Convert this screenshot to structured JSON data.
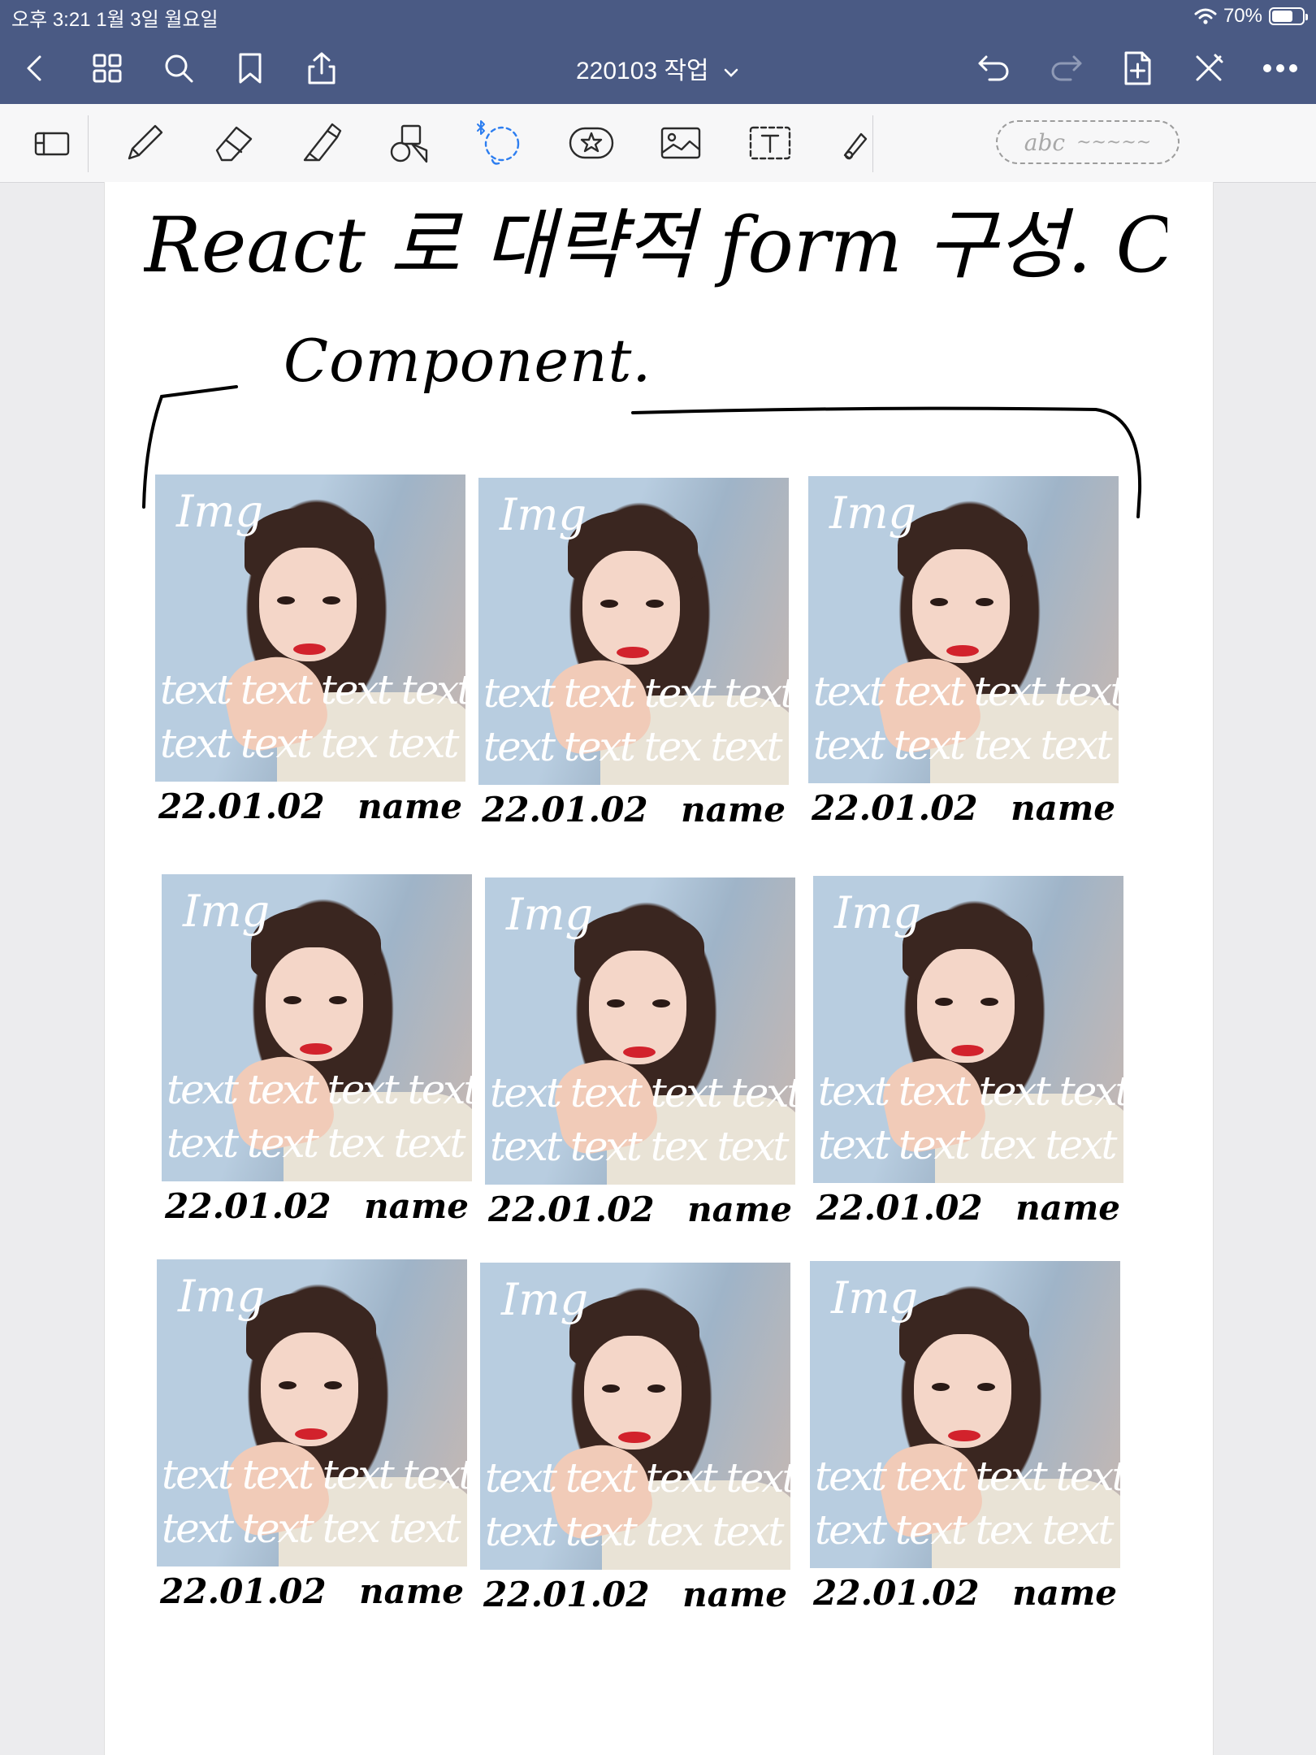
{
  "status_bar": {
    "time": "오후 3:21  1월 3일 월요일",
    "battery": "70%",
    "battery_level": 0.7
  },
  "nav": {
    "doc_title": "220103 작업",
    "buttons": [
      "back-icon",
      "thumbnails-icon",
      "search-icon",
      "bookmark-icon",
      "share-icon",
      "undo-icon",
      "redo-icon",
      "add-page-icon",
      "close-pen-icon",
      "more-icon"
    ]
  },
  "toolbar": {
    "tools": [
      "page-layout-icon",
      "pen-icon",
      "eraser-icon",
      "highlighter-icon",
      "shapes-icon",
      "lasso-icon",
      "sticker-icon",
      "image-icon",
      "text-tool-icon",
      "laser-icon"
    ],
    "text_pill_label": "abc",
    "text_pill_wave": "~~~~~"
  },
  "note": {
    "title": "React 로 대략적 form 구성. CSS 제외.",
    "component_label": "Component.",
    "cards": [
      {
        "img_label": "Img",
        "text_line_1": "text text text text",
        "text_line_2": "text text tex text",
        "date": "22.01.02",
        "name": "name"
      },
      {
        "img_label": "Img",
        "text_line_1": "text text text text",
        "text_line_2": "text text tex text",
        "date": "22.01.02",
        "name": "name"
      },
      {
        "img_label": "Img",
        "text_line_1": "text text text text",
        "text_line_2": "text text tex text",
        "date": "22.01.02",
        "name": "name"
      },
      {
        "img_label": "Img",
        "text_line_1": "text text text text",
        "text_line_2": "text text tex text",
        "date": "22.01.02",
        "name": "name"
      },
      {
        "img_label": "Img",
        "text_line_1": "text text text text",
        "text_line_2": "text text tex text",
        "date": "22.01.02",
        "name": "name"
      },
      {
        "img_label": "Img",
        "text_line_1": "text text text text",
        "text_line_2": "text text tex text",
        "date": "22.01.02",
        "name": "name"
      },
      {
        "img_label": "Img",
        "text_line_1": "text text text text",
        "text_line_2": "text text tex text",
        "date": "22.01.02",
        "name": "name"
      },
      {
        "img_label": "Img",
        "text_line_1": "text text text text",
        "text_line_2": "text text tex text",
        "date": "22.01.02",
        "name": "name"
      },
      {
        "img_label": "Img",
        "text_line_1": "text text text text",
        "text_line_2": "text text tex text",
        "date": "22.01.02",
        "name": "name"
      }
    ]
  }
}
